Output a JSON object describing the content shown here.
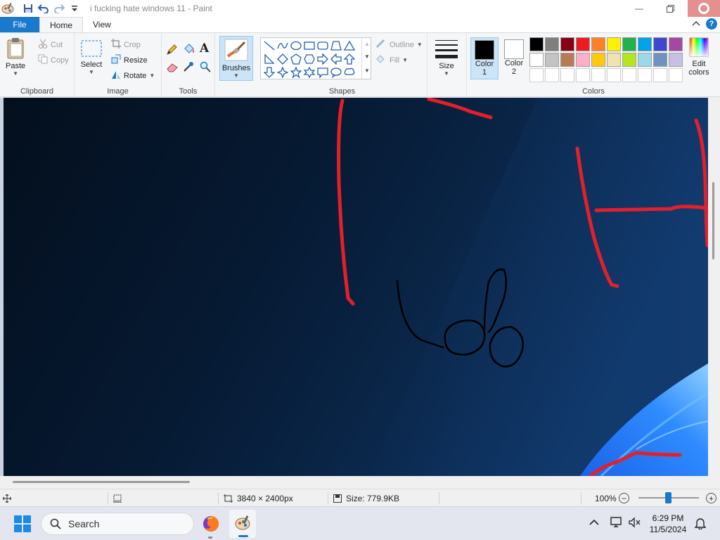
{
  "window": {
    "title": "i fucking hate windows 11 - Paint",
    "controls": [
      "minimize",
      "restore",
      "close"
    ]
  },
  "tabs": {
    "file": "File",
    "home": "Home",
    "view": "View",
    "active": "Home"
  },
  "ribbon": {
    "clipboard": {
      "paste": "Paste",
      "cut": "Cut",
      "copy": "Copy",
      "label": "Clipboard"
    },
    "image": {
      "select": "Select",
      "crop": "Crop",
      "resize": "Resize",
      "rotate": "Rotate",
      "label": "Image"
    },
    "tools": {
      "label": "Tools",
      "text_glyph": "A"
    },
    "brushes": {
      "label": "Brushes"
    },
    "shapes": {
      "outline": "Outline",
      "fill": "Fill",
      "label": "Shapes"
    },
    "size": {
      "label": "Size"
    },
    "colors": {
      "color1_line1": "Color",
      "color1_line2": "1",
      "color2_line1": "Color",
      "color2_line2": "2",
      "color1": "#000000",
      "color2": "#ffffff",
      "edit_line1": "Edit",
      "edit_line2": "colors",
      "label": "Colors",
      "palette_row1": [
        "#000000",
        "#7f7f7f",
        "#880015",
        "#ed1c24",
        "#ff7f27",
        "#fff200",
        "#22b14c",
        "#00a2e8",
        "#3f48cc",
        "#a349a4"
      ],
      "palette_row2": [
        "#ffffff",
        "#c3c3c3",
        "#b97a57",
        "#ffaec9",
        "#ffc90e",
        "#efe4b0",
        "#b5e61d",
        "#99d9ea",
        "#7092be",
        "#c8bfe7"
      ]
    }
  },
  "statusbar": {
    "dimensions": "3840 × 2400px",
    "size": "Size: 779.9KB",
    "zoom": "100%"
  },
  "taskbar": {
    "search_placeholder": "Search",
    "time": "6:29 PM",
    "date": "11/5/2024"
  }
}
